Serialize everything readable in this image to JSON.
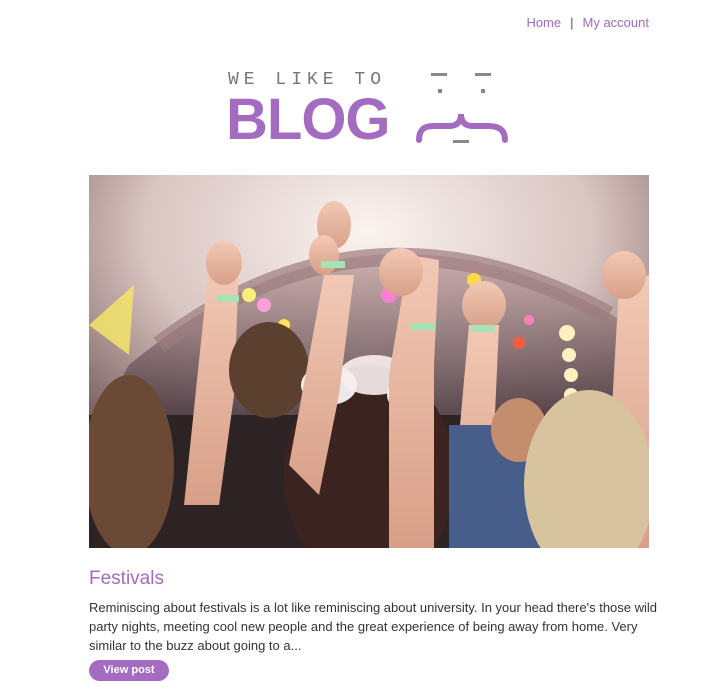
{
  "nav": {
    "home_label": "Home",
    "separator": "|",
    "account_label": "My account"
  },
  "logo": {
    "tagline": "WE LIKE TO",
    "brand": "BLOG"
  },
  "hero": {
    "icon": "festival-crowd-photo"
  },
  "post": {
    "title": "Festivals",
    "excerpt": "Reminiscing about festivals is a lot like reminiscing about university. In your head there's those wild party nights, meeting cool new people and the great experience of being away from home. Very similar to the buzz about going to a...",
    "button_label": "View post"
  },
  "colors": {
    "accent": "#a36cc0",
    "text": "#333333"
  }
}
